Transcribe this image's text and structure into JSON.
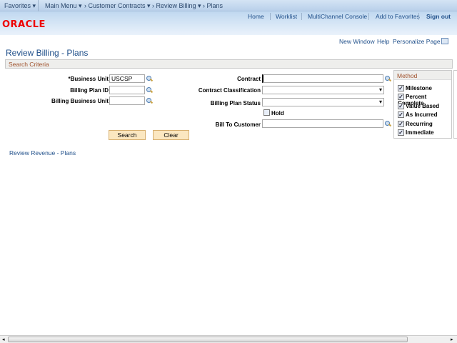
{
  "topnav": {
    "favorites": "Favorites ▾",
    "main_menu": "Main Menu ▾",
    "crumbs": [
      "› Customer Contracts ▾",
      "› Review Billing ▾",
      "› Plans"
    ]
  },
  "header": {
    "links": [
      "Home",
      "Worklist",
      "MultiChannel Console",
      "Add to Favorites"
    ],
    "signout": "Sign out",
    "logo": "ORACLE"
  },
  "page_links": [
    "New Window",
    "Help",
    "Personalize Page"
  ],
  "title": "Review Billing - Plans",
  "section": "Search Criteria",
  "form": {
    "business_unit": {
      "label": "*Business Unit",
      "value": "USCSP"
    },
    "billing_plan_id": {
      "label": "Billing Plan ID",
      "value": ""
    },
    "billing_business_unit": {
      "label": "Billing Business Unit",
      "value": ""
    },
    "contract": {
      "label": "Contract",
      "value": ""
    },
    "contract_classification": {
      "label": "Contract Classification",
      "value": ""
    },
    "billing_plan_status": {
      "label": "Billing Plan Status",
      "value": ""
    },
    "hold": {
      "label": "Hold",
      "checked": false
    },
    "bill_to_customer": {
      "label": "Bill To Customer",
      "value": ""
    }
  },
  "buttons": {
    "search": "Search",
    "clear": "Clear"
  },
  "method": {
    "header": "Method",
    "items": [
      {
        "label": "Milestone",
        "checked": true
      },
      {
        "label": "Percent Complete",
        "checked": true
      },
      {
        "label": "Value Based",
        "checked": true
      },
      {
        "label": "As Incurred",
        "checked": true
      },
      {
        "label": "Recurring",
        "checked": true
      },
      {
        "label": "Immediate",
        "checked": true
      }
    ]
  },
  "footer_link": "Review Revenue - Plans",
  "check": "✓"
}
